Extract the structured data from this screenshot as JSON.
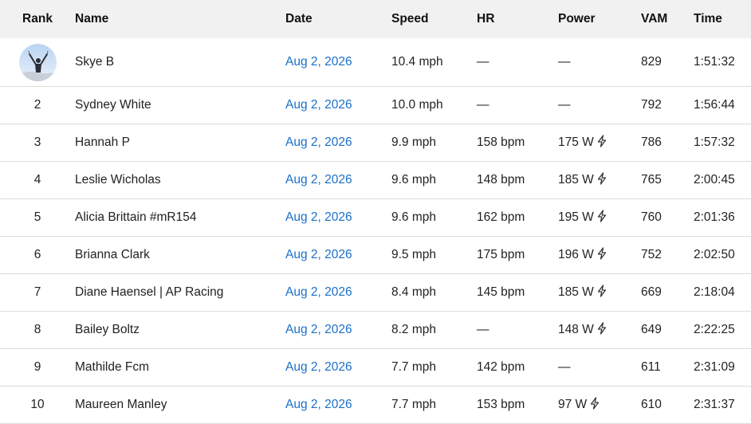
{
  "headers": {
    "rank": "Rank",
    "name": "Name",
    "date": "Date",
    "speed": "Speed",
    "hr": "HR",
    "power": "Power",
    "vam": "VAM",
    "time": "Time"
  },
  "rows": [
    {
      "rank": "",
      "avatar": "athlete-avatar",
      "name": "Skye B",
      "date": "Aug 2, 2026",
      "speed": "10.4 mph",
      "hr": "—",
      "power": "—",
      "power_icon": false,
      "vam": "829",
      "time": "1:51:32"
    },
    {
      "rank": "2",
      "name": "Sydney White",
      "date": "Aug 2, 2026",
      "speed": "10.0 mph",
      "hr": "—",
      "power": "—",
      "power_icon": false,
      "vam": "792",
      "time": "1:56:44"
    },
    {
      "rank": "3",
      "name": "Hannah P",
      "date": "Aug 2, 2026",
      "speed": "9.9 mph",
      "hr": "158 bpm",
      "power": "175 W",
      "power_icon": true,
      "vam": "786",
      "time": "1:57:32"
    },
    {
      "rank": "4",
      "name": "Leslie Wicholas",
      "date": "Aug 2, 2026",
      "speed": "9.6 mph",
      "hr": "148 bpm",
      "power": "185 W",
      "power_icon": true,
      "vam": "765",
      "time": "2:00:45"
    },
    {
      "rank": "5",
      "name": "Alicia Brittain #mR154",
      "date": "Aug 2, 2026",
      "speed": "9.6 mph",
      "hr": "162 bpm",
      "power": "195 W",
      "power_icon": true,
      "vam": "760",
      "time": "2:01:36"
    },
    {
      "rank": "6",
      "name": "Brianna Clark",
      "date": "Aug 2, 2026",
      "speed": "9.5 mph",
      "hr": "175 bpm",
      "power": "196 W",
      "power_icon": true,
      "vam": "752",
      "time": "2:02:50"
    },
    {
      "rank": "7",
      "name": "Diane Haensel | AP Racing",
      "date": "Aug 2, 2026",
      "speed": "8.4 mph",
      "hr": "145 bpm",
      "power": "185 W",
      "power_icon": true,
      "vam": "669",
      "time": "2:18:04"
    },
    {
      "rank": "8",
      "name": "Bailey Boltz",
      "date": "Aug 2, 2026",
      "speed": "8.2 mph",
      "hr": "—",
      "power": "148 W",
      "power_icon": true,
      "vam": "649",
      "time": "2:22:25"
    },
    {
      "rank": "9",
      "name": "Mathilde Fcm",
      "date": "Aug 2, 2026",
      "speed": "7.7 mph",
      "hr": "142 bpm",
      "power": "—",
      "power_icon": false,
      "vam": "611",
      "time": "2:31:09"
    },
    {
      "rank": "10",
      "name": "Maureen Manley",
      "date": "Aug 2, 2026",
      "speed": "7.7 mph",
      "hr": "153 bpm",
      "power": "97 W",
      "power_icon": true,
      "vam": "610",
      "time": "2:31:37"
    }
  ]
}
